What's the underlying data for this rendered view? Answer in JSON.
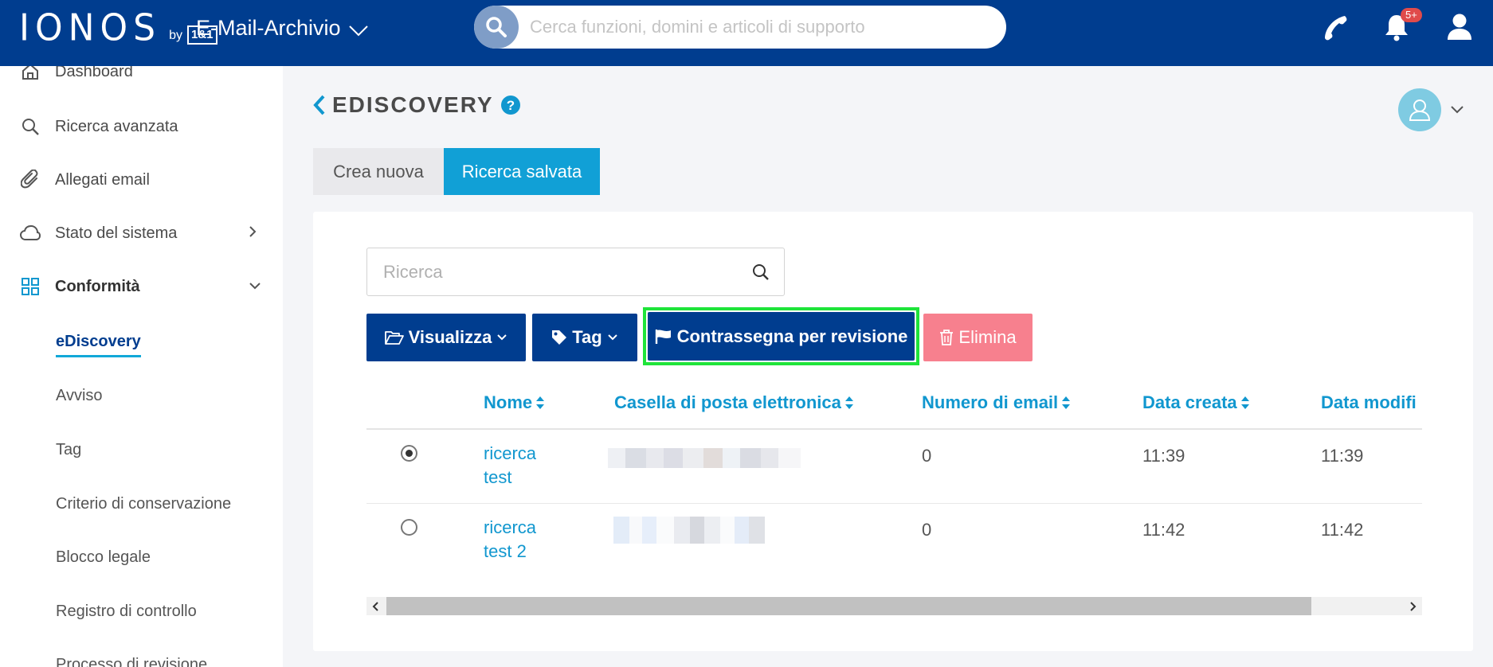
{
  "topbar": {
    "logo": "IONOS",
    "logo_by": "by",
    "logo_brand": "1&1",
    "app_name": "E-Mail-Archivio",
    "search_placeholder": "Cerca funzioni, domini e articoli di supporto",
    "notification_badge": "5+",
    "icons": [
      "search-icon",
      "phone-icon",
      "bell-icon",
      "user-icon"
    ]
  },
  "sidebar": {
    "items": [
      {
        "label": "Dashboard",
        "icon": "home-icon"
      },
      {
        "label": "Ricerca avanzata",
        "icon": "search-icon"
      },
      {
        "label": "Allegati email",
        "icon": "paperclip-icon"
      },
      {
        "label": "Stato del sistema",
        "icon": "cloud-icon"
      },
      {
        "label": "Conformità",
        "icon": "grid-icon"
      }
    ],
    "subitems": [
      "eDiscovery",
      "Avviso",
      "Tag",
      "Criterio di conservazione",
      "Blocco legale",
      "Registro di controllo",
      "Processo di revisione"
    ],
    "active_subitem": "eDiscovery"
  },
  "page": {
    "title": "EDISCOVERY",
    "tabs": [
      "Crea nuova",
      "Ricerca salvata"
    ],
    "active_tab": "Ricerca salvata"
  },
  "toolbar": {
    "search_placeholder": "Ricerca",
    "view_label": "Visualizza",
    "tag_label": "Tag",
    "flag_label": "Contrassegna per revisione",
    "delete_label": "Elimina"
  },
  "table": {
    "columns": [
      "Nome",
      "Casella di posta elettronica",
      "Numero di email",
      "Data creata",
      "Data modifi"
    ],
    "rows": [
      {
        "selected": true,
        "name_line1": "ricerca",
        "name_line2": "test",
        "mailbox": "",
        "count": "0",
        "created": "11:39",
        "modified": "11:39"
      },
      {
        "selected": false,
        "name_line1": "ricerca",
        "name_line2": "test 2",
        "mailbox": "",
        "count": "0",
        "created": "11:42",
        "modified": "11:42"
      }
    ]
  },
  "colors": {
    "brand": "#003d8f",
    "accent": "#11a0d6",
    "link": "#1197cf",
    "danger": "#f7808e",
    "highlight": "#1fe43a"
  }
}
